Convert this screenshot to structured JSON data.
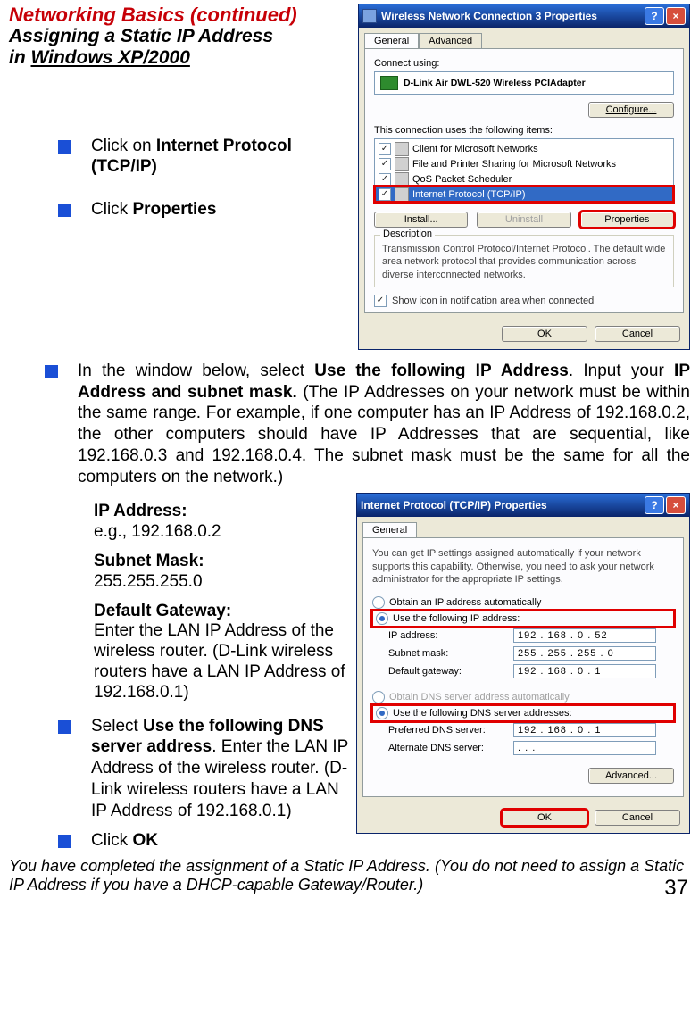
{
  "heading": {
    "line1a": "Networking Basics ",
    "line1b": "(continued)",
    "line2": "Assigning a Static IP Address",
    "line3a": "in ",
    "line3b": "Windows XP/2000"
  },
  "bullets": {
    "b1a": "Click on ",
    "b1b": "Internet Protocol (TCP/IP)",
    "b2a": "Click ",
    "b2b": "Properties",
    "b3a": " In the window below, select ",
    "b3b": "Use the following IP Address",
    "b3c": ". Input your ",
    "b3d": "IP Address and subnet mask.",
    "b3e": " (The IP Addresses on your network must be within the same range. For example, if one computer has an IP Address of 192.168.0.2, the other computers should have IP Addresses that are sequential, like 192.168.0.3 and 192.168.0.4. The subnet mask must be the same for all the computers on the network.)",
    "b4a": "Select ",
    "b4b": "Use the following DNS server address",
    "b4c": ". Enter the LAN IP Address of the wireless router. (D-Link wireless routers have a LAN IP Address of 192.168.0.1)",
    "b5a": "Click ",
    "b5b": "OK"
  },
  "info": {
    "ip_label": "IP Address:",
    "ip_value": "e.g., 192.168.0.2",
    "subnet_label": "Subnet Mask:",
    "subnet_value": "255.255.255.0",
    "gateway_label": "Default Gateway:",
    "gateway_text": "Enter the LAN IP Address of the wireless router. (D-Link wireless routers have a LAN IP Address of 192.168.0.1)"
  },
  "dialog1": {
    "title": "Wireless Network Connection 3 Properties",
    "tab_general": "General",
    "tab_advanced": "Advanced",
    "connect_using": "Connect using:",
    "adapter": "D-Link Air DWL-520 Wireless PCIAdapter",
    "configure": "Configure...",
    "uses_items": "This connection uses the following items:",
    "items": {
      "i1": "Client for Microsoft Networks",
      "i2": "File and Printer Sharing for Microsoft Networks",
      "i3": "QoS Packet Scheduler",
      "i4": "Internet Protocol (TCP/IP)"
    },
    "install": "Install...",
    "uninstall": "Uninstall",
    "properties": "Properties",
    "desc_label": "Description",
    "desc_text": "Transmission Control Protocol/Internet Protocol. The default wide area network protocol that provides communication across diverse interconnected networks.",
    "show_icon": "Show icon in notification area when connected",
    "ok": "OK",
    "cancel": "Cancel"
  },
  "dialog2": {
    "title": "Internet Protocol (TCP/IP) Properties",
    "tab_general": "General",
    "intro": "You can get IP settings assigned automatically if your network supports this capability. Otherwise, you need to ask your network administrator for the appropriate IP settings.",
    "r1": "Obtain an IP address automatically",
    "r2": "Use the following IP address:",
    "ip_label": "IP address:",
    "ip_value": "192 . 168 .   0   .  52",
    "sm_label": "Subnet mask:",
    "sm_value": "255 . 255 . 255 .   0",
    "gw_label": "Default gateway:",
    "gw_value": "192 . 168 .   0   .   1",
    "r3": "Obtain DNS server address automatically",
    "r4": "Use the following DNS server addresses:",
    "pdns_label": "Preferred DNS server:",
    "pdns_value": "192 . 168 .   0   .   1",
    "adns_label": "Alternate DNS server:",
    "adns_value": ".        .        .",
    "advanced": "Advanced...",
    "ok": "OK",
    "cancel": "Cancel"
  },
  "footer": {
    "note": "You have completed the assignment of a Static IP Address.  (You do not need to assign a Static IP Address if you have a DHCP-capable Gateway/Router.)",
    "page": "37"
  }
}
